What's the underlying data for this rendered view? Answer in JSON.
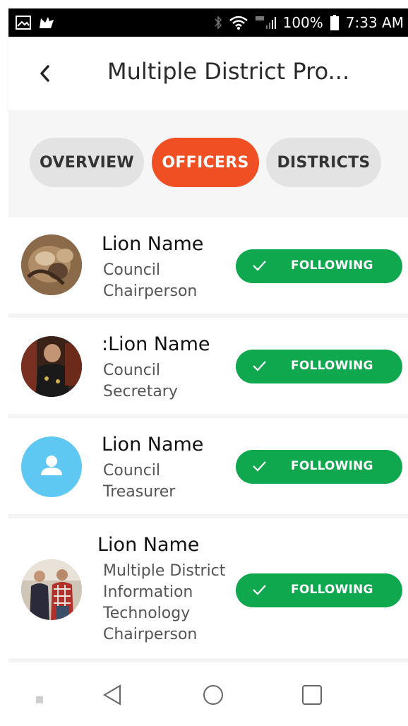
{
  "status_bar": {
    "battery": "100%",
    "time": "7:33 AM",
    "icons": [
      "gallery-icon",
      "notification-icon",
      "bluetooth-icon",
      "wifi-icon",
      "signal-icon",
      "battery-icon"
    ]
  },
  "header": {
    "title": "Multiple District Pro...",
    "back_icon": "back-arrow-icon"
  },
  "tabs": [
    {
      "label": "OVERVIEW",
      "active": false
    },
    {
      "label": "OFFICERS",
      "active": true
    },
    {
      "label": "DISTRICTS",
      "active": false
    }
  ],
  "officers": [
    {
      "name": "Lion Name",
      "role_lines": [
        "Council",
        "Chairperson"
      ],
      "button": "FOLLOWING",
      "avatar": "lion-photo"
    },
    {
      "name": ":Lion Name",
      "role_lines": [
        "Council",
        "Secretary"
      ],
      "button": "FOLLOWING",
      "avatar": "person-photo"
    },
    {
      "name": "Lion Name",
      "role_lines": [
        "Council",
        "Treasurer"
      ],
      "button": "FOLLOWING",
      "avatar": "default-user-icon"
    },
    {
      "name": "Lion Name",
      "role_lines": [
        "Multiple District",
        "Information",
        "Technology",
        "Chairperson"
      ],
      "button": "FOLLOWING",
      "avatar": "group-photo"
    }
  ],
  "colors": {
    "accent": "#f04e23",
    "follow_green": "#10a84f",
    "tab_inactive": "#e3e3e3",
    "default_avatar": "#5ec8f2"
  },
  "nav_bar": {
    "icons": [
      "recent-dot-icon",
      "back-triangle-icon",
      "home-circle-icon",
      "overview-square-icon"
    ]
  }
}
